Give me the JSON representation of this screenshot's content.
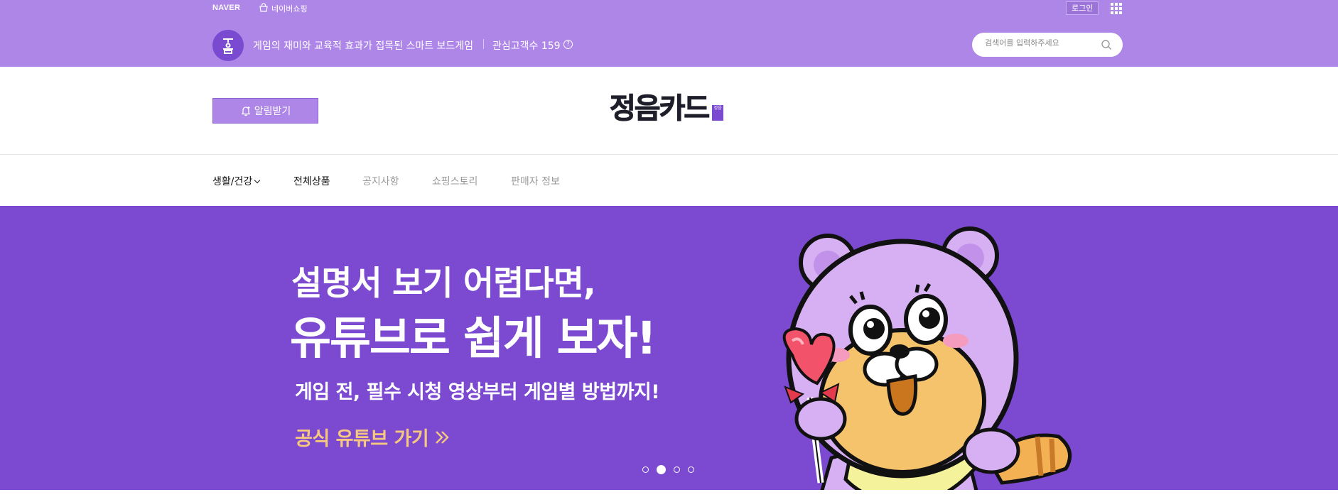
{
  "gnb": {
    "naver_logo": "NAVER",
    "shopping_label": "네이버쇼핑",
    "login_label": "로그인"
  },
  "store": {
    "icon_text": "정음",
    "description": "게임의 재미와 교육적 효과가 접목된 스마트 보드게임",
    "fans_label": "관심고객수 159",
    "help_label": "?",
    "search_placeholder": "검색어를 입력하주세요"
  },
  "header": {
    "alert_label": "알림받기",
    "brand_name": "정음카드",
    "brand_mini": "정음"
  },
  "nav": {
    "items": [
      {
        "label": "생활/건강"
      },
      {
        "label": "전체상품"
      },
      {
        "label": "공지사항"
      },
      {
        "label": "쇼핑스토리"
      },
      {
        "label": "판매자 정보"
      }
    ]
  },
  "banner": {
    "headline1": "설명서 보기 어렵다면,",
    "headline2": "유튜브로 쉽게 보자!",
    "subline": "게임 전, 필수 시청 영상부터 게임별 방법까지!",
    "cta_label": "공식 유튜브 가기",
    "slide_count": 4,
    "active_slide": 2
  },
  "colors": {
    "header_purple": "#ad86e8",
    "banner_purple": "#7b4ad0",
    "cta_gold": "#f6c77f"
  }
}
